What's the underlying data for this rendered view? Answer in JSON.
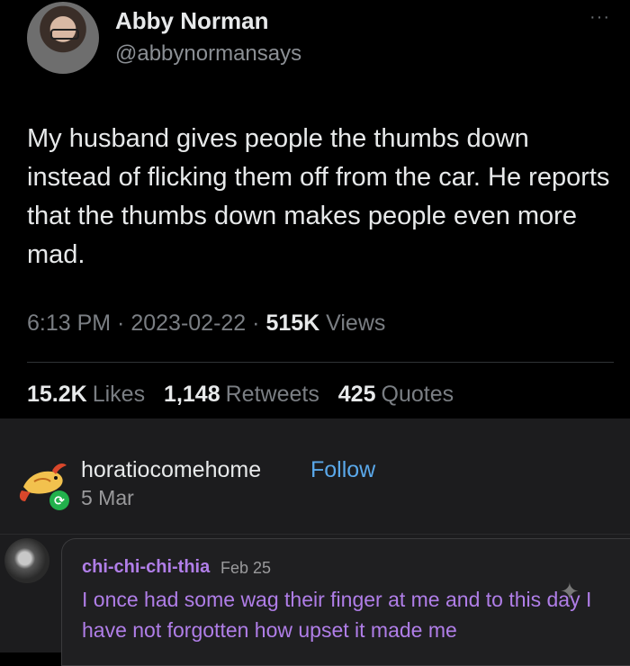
{
  "tweet": {
    "author_name": "Abby Norman",
    "handle": "@abbynormansays",
    "more_icon": "···",
    "text": "My husband gives people the thumbs down instead of flicking them off from the car. He reports that the thumbs down makes people even more mad.",
    "time": "6:13 PM",
    "date": "2023-02-22",
    "sep": " · ",
    "views_count": "515K",
    "views_label": "Views",
    "likes_count": "15.2K",
    "likes_label": "Likes",
    "retweets_count": "1,148",
    "retweets_label": "Retweets",
    "quotes_count": "425",
    "quotes_label": "Quotes"
  },
  "reblog": {
    "username": "horatiocomehome",
    "follow_label": "Follow",
    "date": "5 Mar",
    "badge_icon": "⟳"
  },
  "comment": {
    "username": "chi-chi-chi-thia",
    "date": "Feb 25",
    "text": "I once had some wag their finger at me and to this day I have not forgotten how upset it made me",
    "sparkle_icon": "✦"
  },
  "colors": {
    "background": "#000000",
    "reblog_background": "#1c1c1e",
    "follow_blue": "#5aa8ea",
    "comment_purple": "#b07ee8",
    "reblog_green": "#22b14c"
  }
}
